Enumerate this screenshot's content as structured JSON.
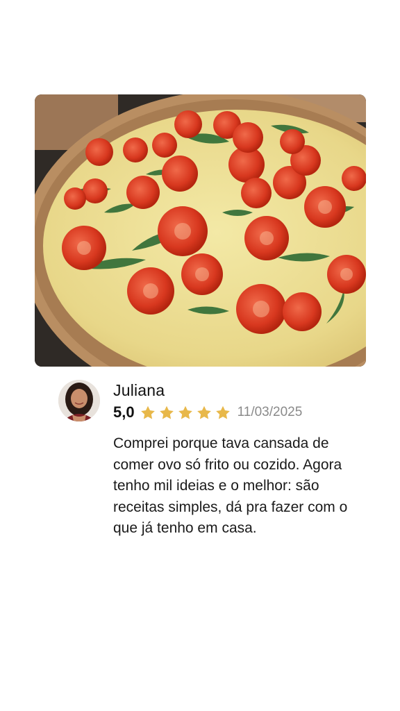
{
  "review": {
    "reviewer_name": "Juliana",
    "rating_value": "5,0",
    "rating_stars": 5,
    "rating_max": 5,
    "date": "11/03/2025",
    "text": "Comprei porque tava cansada de comer ovo só frito ou cozido. Agora tenho mil ideias e o melhor: são receitas simples, dá pra fazer com o que já tenho em casa."
  },
  "colors": {
    "star": "#E8B84A",
    "date": "#8A8A8A",
    "text": "#1A1A1A",
    "background": "#FFFFFF"
  },
  "icons": {
    "star": "star-icon",
    "photo": "quiche-photo",
    "avatar": "user-avatar"
  }
}
